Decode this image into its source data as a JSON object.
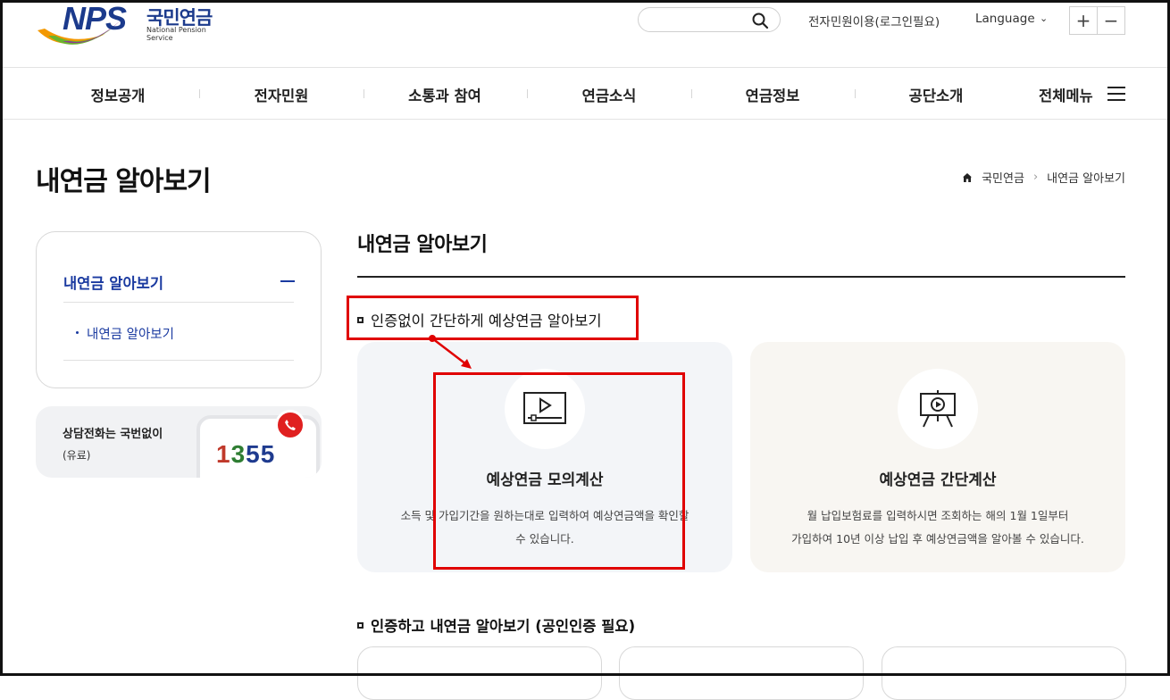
{
  "header": {
    "logo_text": "NPS",
    "logo_ko": "국민연금",
    "logo_en": "National Pension Service",
    "search_placeholder": "",
    "civil_link": "전자민원이용(로그인필요)",
    "language": "Language",
    "zoom_in": "+",
    "zoom_out": "−"
  },
  "gnb": {
    "items": [
      "정보공개",
      "전자민원",
      "소통과 참여",
      "연금소식",
      "연금정보",
      "공단소개"
    ],
    "all_menu": "전체메뉴"
  },
  "page": {
    "title": "내연금 알아보기",
    "breadcrumb": [
      "국민연금",
      "내연금 알아보기"
    ]
  },
  "sidebar": {
    "title": "내연금 알아보기",
    "sub_item": "내연금 알아보기",
    "call_title": "상담전화는 국번없이",
    "call_sub": "(유료)",
    "call_number_digits": [
      "1",
      "3",
      "5",
      "5"
    ],
    "call_number_colors": [
      "#c0392b",
      "#2e7d32",
      "#1f3b8f",
      "#1f3b8f"
    ]
  },
  "content": {
    "title": "내연금 알아보기",
    "section1": "인증없이 간단하게 예상연금 알아보기",
    "card1": {
      "title": "예상연금 모의계산",
      "desc_line1": "소득 및 가입기간을 원하는대로 입력하여 예상연금액을 확인할",
      "desc_line2": "수 있습니다."
    },
    "card2": {
      "title": "예상연금 간단계산",
      "desc_line1": "월 납입보험료를 입력하시면 조회하는 해의 1월 1일부터",
      "desc_line2": "가입하여 10년 이상 납입 후 예상연금액을 알아볼 수 있습니다."
    },
    "section2": "인증하고 내연금 알아보기 (공인인증 필요)"
  },
  "icons": {
    "search": "search-icon",
    "chevron": "chevron-down-icon",
    "home": "home-icon",
    "menu": "hamburger-icon",
    "video": "video-player-icon",
    "presentation": "presentation-play-icon",
    "phone": "phone-icon"
  },
  "colors": {
    "brand_blue": "#1a3aa0",
    "card1_bg": "#f3f5f8",
    "card2_bg": "#f8f6f2",
    "annotation_red": "#e00000"
  }
}
